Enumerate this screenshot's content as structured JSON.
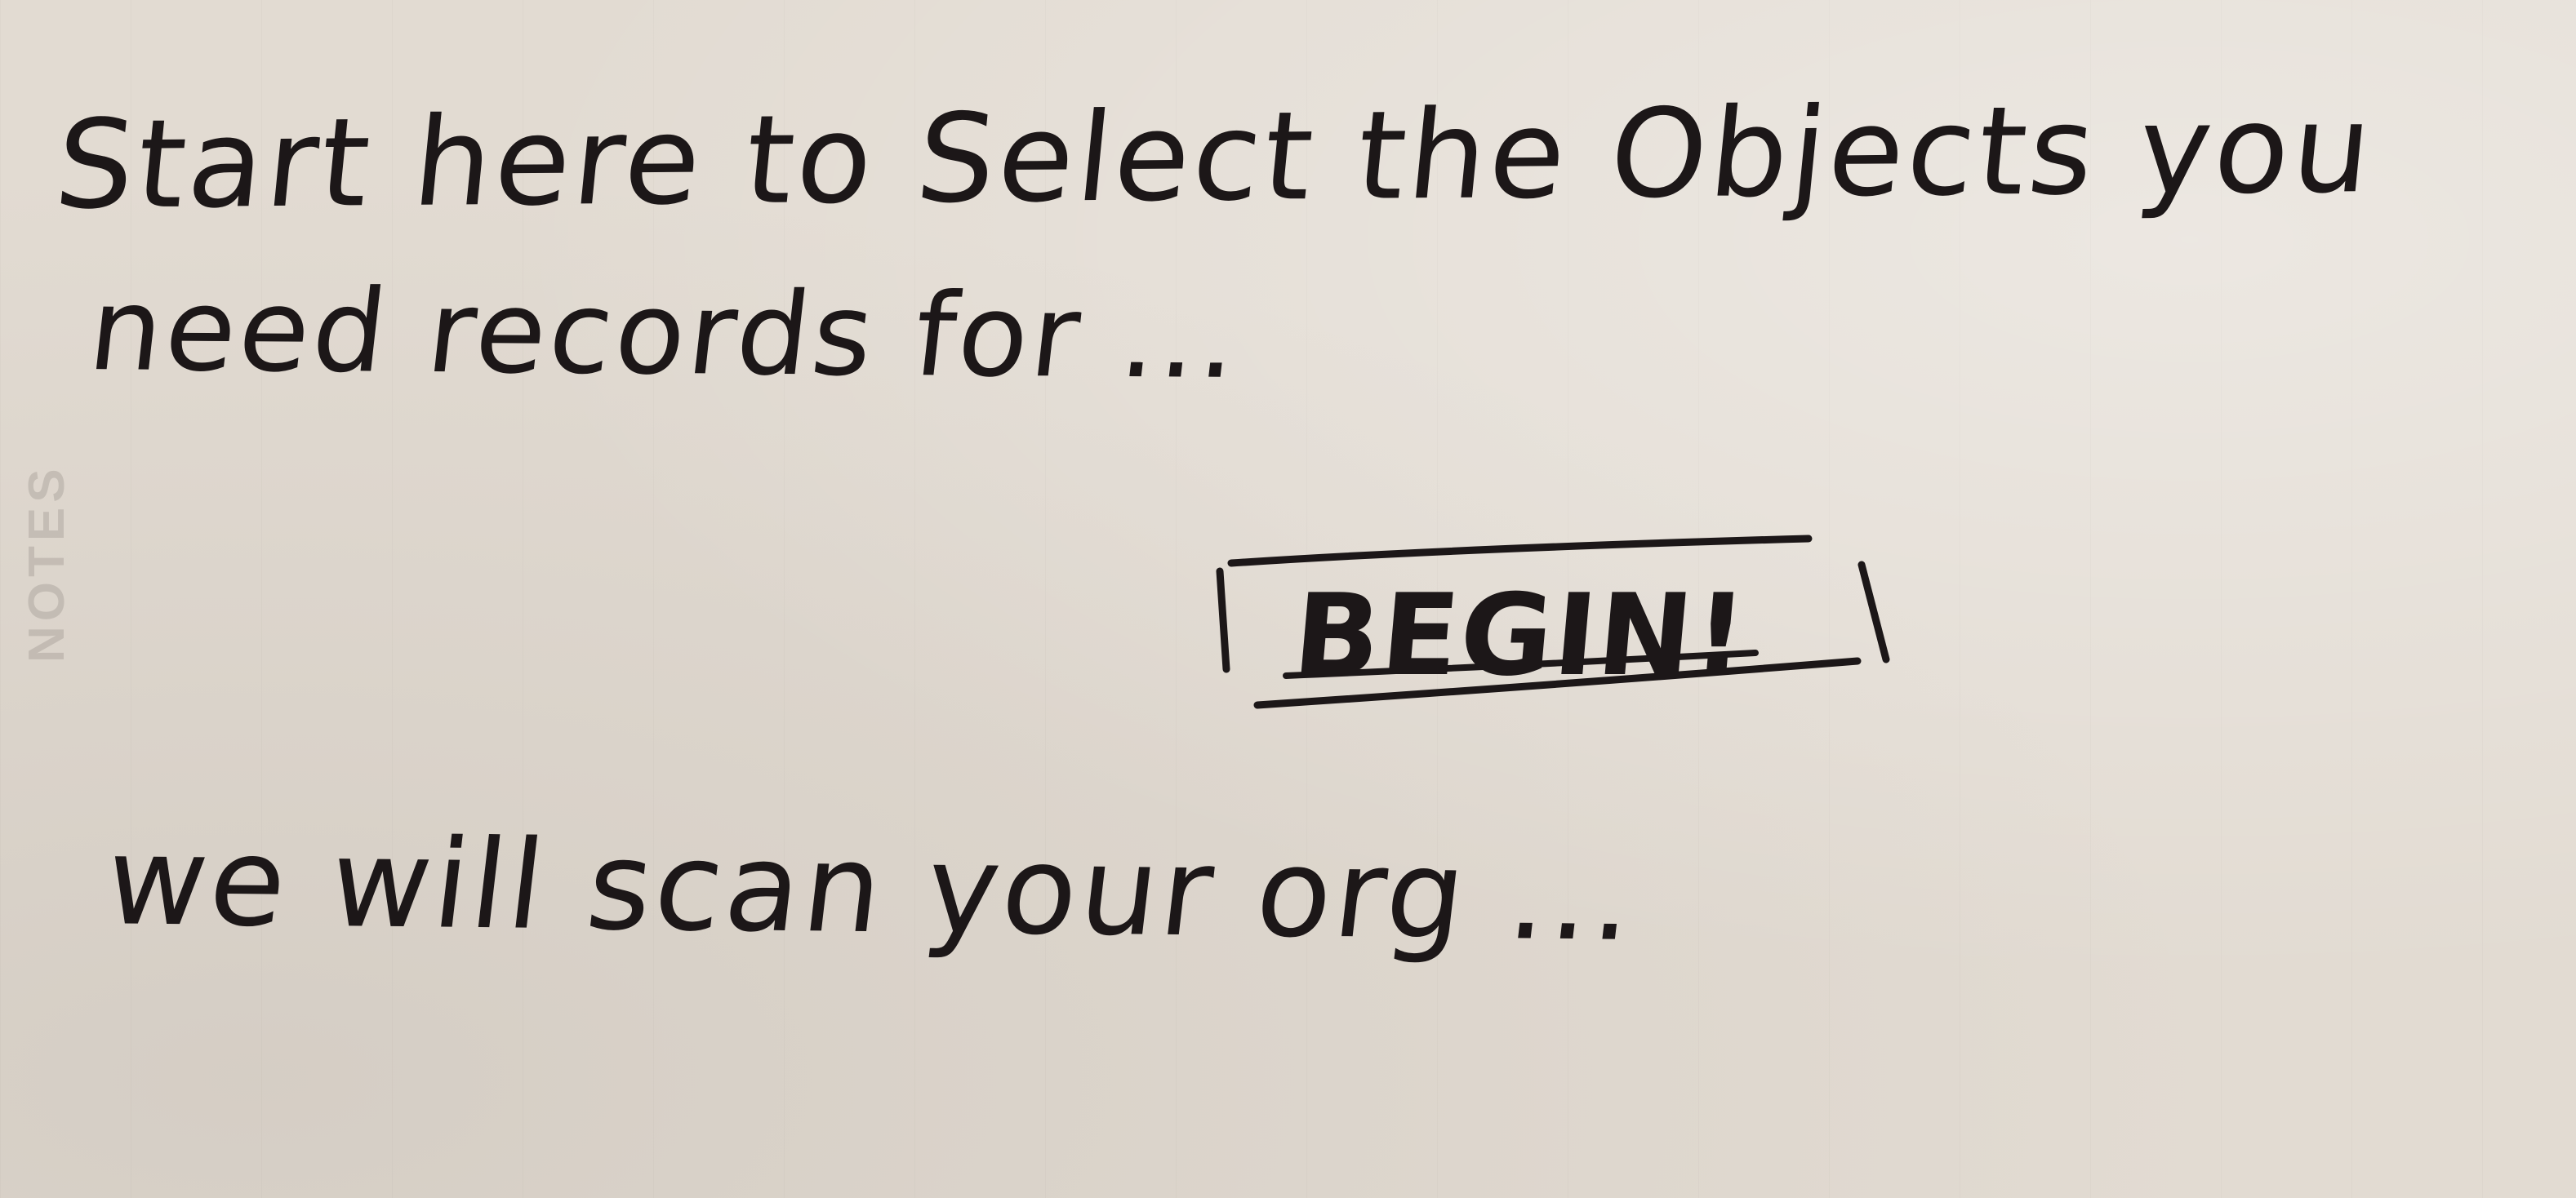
{
  "sketch": {
    "side_print": "NOTES",
    "prompt_line_1": "Start here to Select the Objects you",
    "prompt_line_2": "need records for ...",
    "begin_button_label": "BEGIN!",
    "scan_message": "we will scan your org ..."
  },
  "colors": {
    "paper": "#e2dbd2",
    "ink": "#1c1718"
  }
}
